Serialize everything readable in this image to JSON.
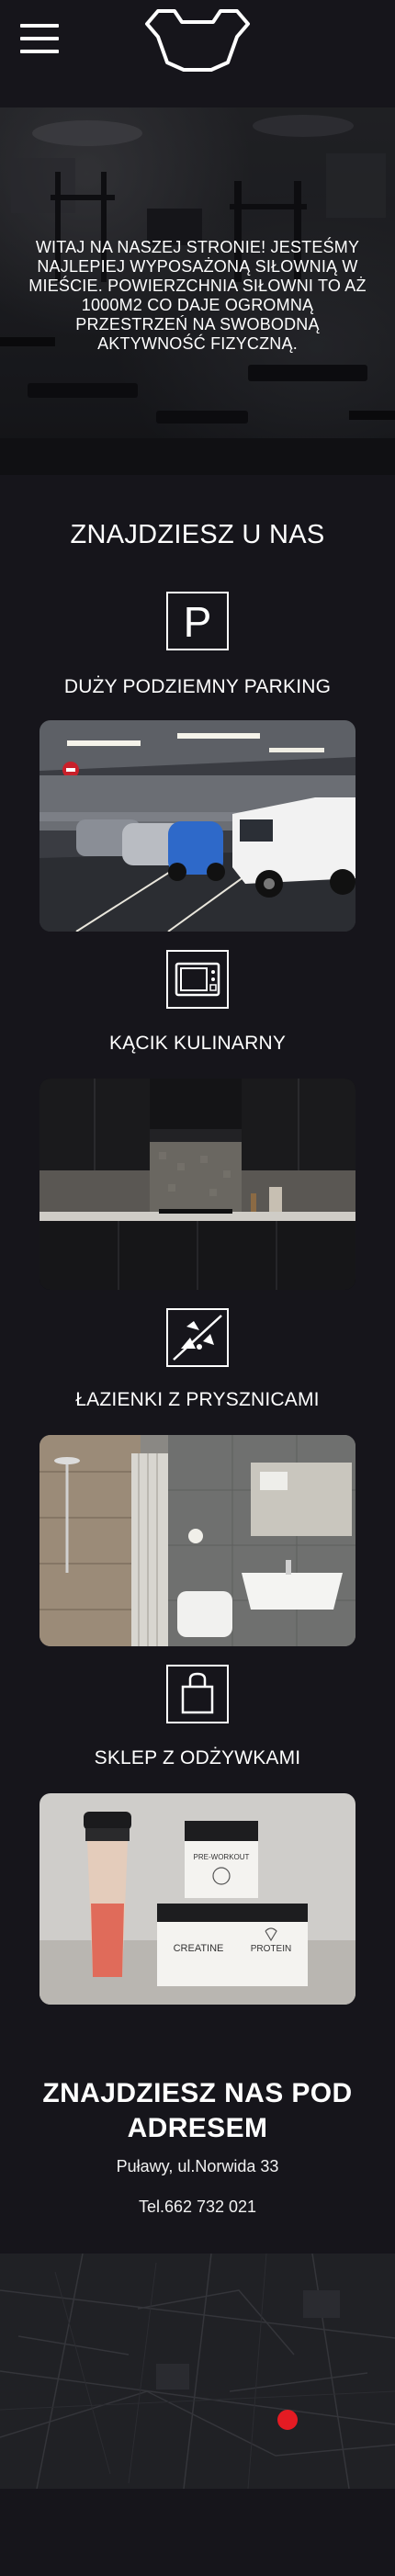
{
  "header": {
    "menu_icon": "hamburger-menu-icon",
    "logo_icon": "gym-logo-icon"
  },
  "hero": {
    "text": "Witaj na naszej stronie! Jesteśmy najlepiej wyposażoną siłownią w mieście. Powierzchnia siłowni to aż 1000m2 co daje ogromną przestrzeń na swobodną aktywność fizyczną."
  },
  "features": {
    "title": "ZNAJDZIESZ U NAS",
    "items": [
      {
        "icon": "parking-icon",
        "label": "Duży podziemny parking"
      },
      {
        "icon": "microwave-icon",
        "label": "Kącik kulinarny"
      },
      {
        "icon": "shower-icon",
        "label": "Łazienki z prysznicami"
      },
      {
        "icon": "shopping-bag-icon",
        "label": "Sklep z odżywkami"
      }
    ],
    "parking_letter": "P",
    "supplement_labels": [
      "PRE-WORKOUT",
      "CREATINE",
      "PROTEIN"
    ]
  },
  "address": {
    "title": "Znajdziesz nas pod adresem",
    "street": "Puławy, ul.Norwida 33",
    "phone": "Tel.662 732 021"
  },
  "map": {
    "marker_icon": "map-pin-icon",
    "marker_color": "#e41b23"
  },
  "colors": {
    "background": "#16151b",
    "text": "#ffffff",
    "accent": "#e41b23"
  }
}
